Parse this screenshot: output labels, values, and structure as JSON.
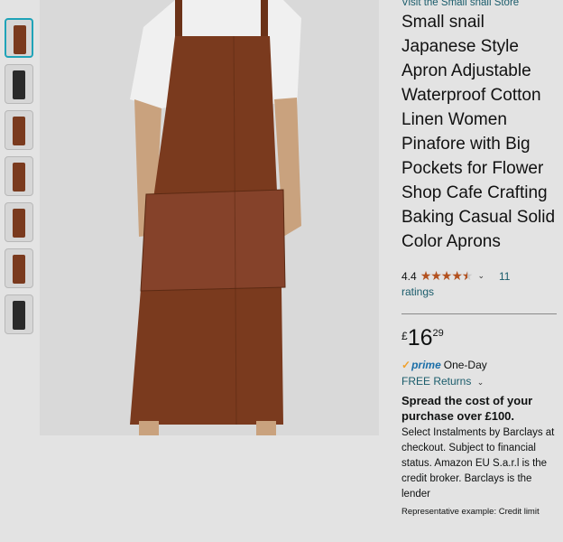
{
  "store_link": "Visit the Small snail Store",
  "title": "Small snail Japanese Style Apron Adjustable Waterproof Cotton Linen Women Pinafore with Big Pockets for Flower Shop Cafe Crafting Baking Casual Solid Color Aprons",
  "rating": {
    "value": "4.4",
    "stars_filled": 4.5,
    "count": "11",
    "label": "ratings"
  },
  "price": {
    "currency": "£",
    "whole": "16",
    "fraction": "29"
  },
  "delivery": {
    "prime_check": "✓",
    "prime_word": "prime",
    "prime_text": "One-Day",
    "returns": "FREE Returns"
  },
  "instalments": {
    "headline": "Spread the cost of your purchase over £100.",
    "detail": "Select Instalments by Barclays at checkout. Subject to financial status. Amazon EU S.a.r.l is the credit broker. Barclays is the lender",
    "representative": "Representative example: Credit limit"
  },
  "colors": {
    "apron": "#7a3a1e",
    "accent_link": "#1a5c6b",
    "star": "#b3511f"
  },
  "icons": {
    "share": "share-icon",
    "chevron": "chevron-down-icon"
  }
}
